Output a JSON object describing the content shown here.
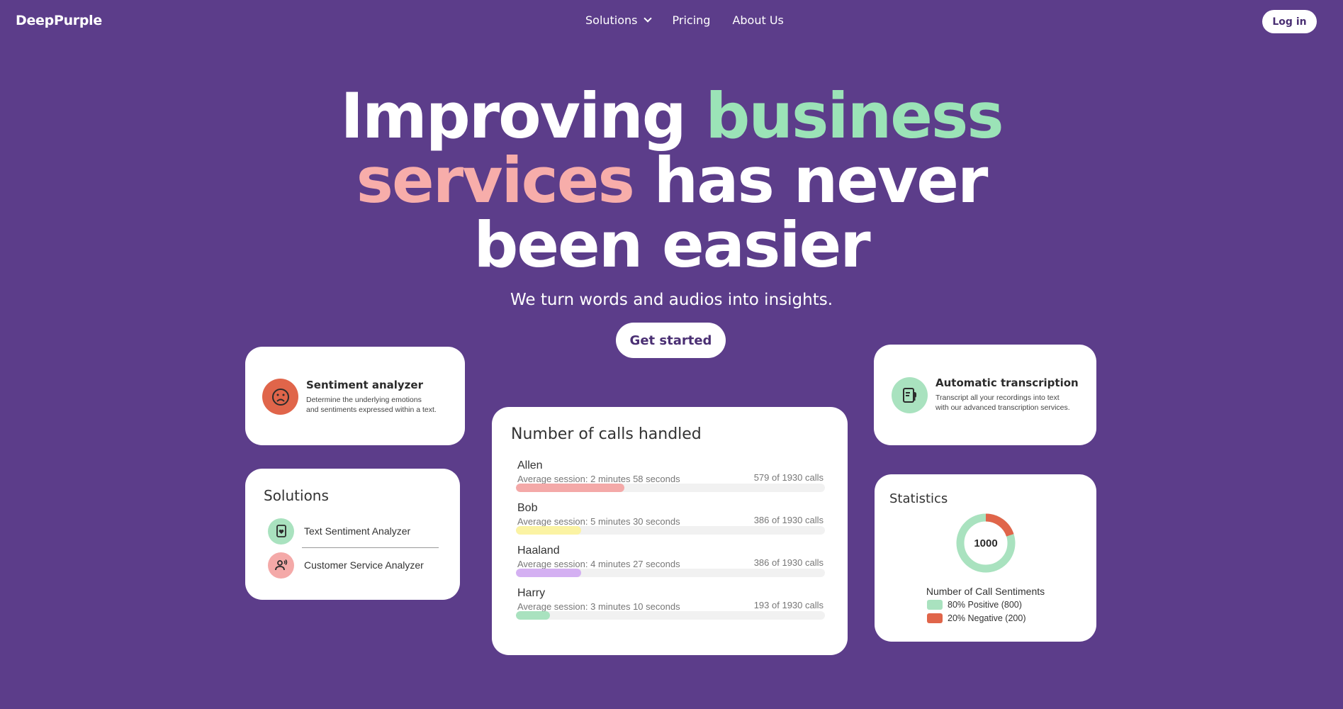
{
  "brand": "DeepPurple",
  "nav": {
    "solutions": "Solutions",
    "pricing": "Pricing",
    "about": "About Us",
    "login": "Log in"
  },
  "hero": {
    "w1": "Improving",
    "w2": "business",
    "w3": "services",
    "w4": "has never",
    "w5": "been easier",
    "subtitle": "We turn words and audios into insights.",
    "cta": "Get started"
  },
  "sentiment_card": {
    "title": "Sentiment analyzer",
    "desc1": "Determine the underlying emotions",
    "desc2": "and sentiments expressed within a text."
  },
  "transcription_card": {
    "title": "Automatic transcription",
    "desc1": "Transcript all your recordings into text",
    "desc2": "with our advanced transcription services."
  },
  "solutions_card": {
    "title": "Solutions",
    "items": [
      {
        "label": "Text Sentiment Analyzer"
      },
      {
        "label": "Customer Service Analyzer"
      }
    ]
  },
  "calls_card": {
    "title": "Number of calls handled",
    "rows": [
      {
        "name": "Allen",
        "avg": "Average session: 2 minutes 58 seconds",
        "count": "579 of 1930 calls",
        "fraction": 0.35,
        "color": "#f4a9a8"
      },
      {
        "name": "Bob",
        "avg": "Average session: 5 minutes 30 seconds",
        "count": "386 of 1930 calls",
        "fraction": 0.21,
        "color": "#fbf3a3"
      },
      {
        "name": "Haaland",
        "avg": "Average session: 4 minutes 27 seconds",
        "count": "386 of 1930 calls",
        "fraction": 0.21,
        "color": "#d4b0f2"
      },
      {
        "name": "Harry",
        "avg": "Average session: 3 minutes 10 seconds",
        "count": "193 of 1930 calls",
        "fraction": 0.11,
        "color": "#a9e2bf"
      }
    ]
  },
  "statistics_card": {
    "title": "Statistics",
    "center": "1000",
    "caption": "Number of Call Sentiments",
    "legend": [
      {
        "label": "80% Positive (800)",
        "color": "#a9e2bf"
      },
      {
        "label": "20% Negative (200)",
        "color": "#e0654a"
      }
    ]
  },
  "chart_data": {
    "type": "pie",
    "title": "Number of Call Sentiments",
    "categories": [
      "Positive",
      "Negative"
    ],
    "values": [
      800,
      200
    ],
    "total": 1000
  },
  "colors": {
    "background": "#5c3d8a",
    "green": "#9be3b7",
    "pink": "#f7adaa",
    "negative": "#e0654a"
  }
}
